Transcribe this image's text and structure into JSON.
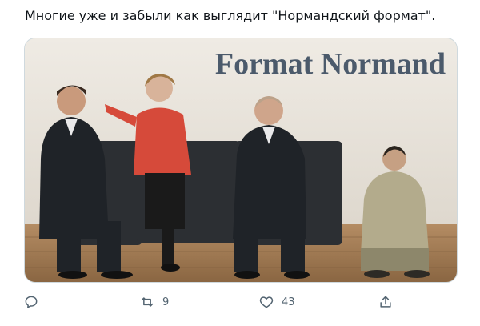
{
  "tweet": {
    "text": "Многие уже и забыли как выглядит \"Нормандский формат\".",
    "media": {
      "overlay_text": "Format Normand",
      "colors": {
        "wall": "#e8e3db",
        "floor": "#a7835d",
        "overlay_text": "#4b5a6b",
        "jacket_red": "#d64a3a"
      }
    },
    "actions": {
      "reply": {
        "icon": "reply-icon",
        "count": ""
      },
      "retweet": {
        "icon": "retweet-icon",
        "count": "9"
      },
      "like": {
        "icon": "heart-icon",
        "count": "43"
      },
      "share": {
        "icon": "share-icon",
        "count": ""
      }
    }
  },
  "colors": {
    "text": "#0f1419",
    "muted": "#536471",
    "border": "#cfd9de"
  }
}
